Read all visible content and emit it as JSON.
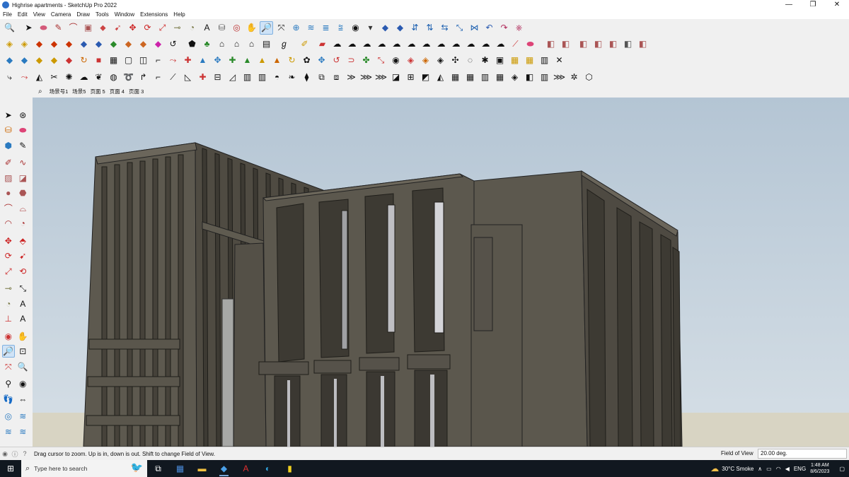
{
  "window": {
    "title": "Highrise apartments - SketchUp Pro 2022",
    "controls": [
      "—",
      "❐",
      "✕"
    ]
  },
  "menu": [
    "File",
    "Edit",
    "View",
    "Camera",
    "Draw",
    "Tools",
    "Window",
    "Extensions",
    "Help"
  ],
  "scenes": [
    "场景号1",
    "场景5",
    "页面 5",
    "页面 4",
    "页面 3"
  ],
  "status": {
    "message": "Drag cursor to zoom.  Up is in, down is out. Shift to change Field of View.",
    "measurement_label": "Field of View",
    "measurement_value": "20.00 deg."
  },
  "taskbar": {
    "search_placeholder": "Type here to search",
    "weather": "30°C  Smoke",
    "language": "ENG",
    "time": "1:48 AM",
    "date": "8/6/2023"
  },
  "icons": {
    "toolbar_row1": [
      "zoom-icon",
      "select-icon",
      "eraser-icon",
      "line-icon",
      "freehand-icon",
      "rectangle-icon",
      "pushpull-icon",
      "move-icon",
      "rotate-icon",
      "scale-icon",
      "offset-icon",
      "tape-icon",
      "text-icon",
      "paint-icon",
      "orbit-icon",
      "pan-icon",
      "zoom-tool-icon",
      "zoom-extents-icon",
      "section-icon",
      "layers-icon",
      "styles-icon",
      "scenes-icon",
      "shadows-icon",
      "camera-icon",
      "walk-icon",
      "lookaround-icon",
      "position-camera-icon",
      "undo-icon",
      "redo-icon",
      "sandbox-icon"
    ],
    "accent": "#2d6ec7"
  },
  "sky_color": "#c5d2de",
  "ground_color": "#d8d4c3",
  "building_color": "#59554c"
}
